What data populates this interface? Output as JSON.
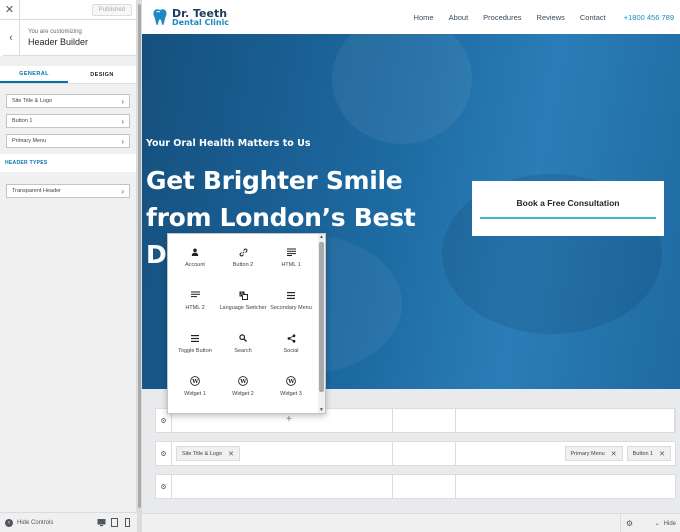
{
  "sidebar": {
    "close_label": "✕",
    "publish_label": "Published",
    "back_label": "‹",
    "crumb": "You are customizing",
    "title": "Header Builder",
    "tabs": [
      {
        "label": "General"
      },
      {
        "label": "Design"
      }
    ],
    "items": [
      {
        "label": "Site Title & Logo"
      },
      {
        "label": "Button 1"
      },
      {
        "label": "Primary Menu"
      }
    ],
    "section_heading": "Header Types",
    "items2": [
      {
        "label": "Transparent Header"
      }
    ],
    "footer": {
      "hide_controls_label": "Hide Controls"
    }
  },
  "site": {
    "logo_line1": "Dr. Teeth",
    "logo_line2": "Dental Clinic",
    "nav": [
      "Home",
      "About",
      "Procedures",
      "Reviews",
      "Contact"
    ],
    "phone": "+1800 456 789",
    "hero_subtitle": "Your Oral Health Matters to Us",
    "hero_title": "Get Brighter Smile\nfrom London’s Best\nD",
    "cta_label": "Book a Free Consultation",
    "brand_color": "#1e88c7",
    "accent_color": "#40b5c5"
  },
  "picker": {
    "items": [
      {
        "label": "Account",
        "icon": "user-icon"
      },
      {
        "label": "Button 2",
        "icon": "link-icon"
      },
      {
        "label": "HTML 1",
        "icon": "text-lines-icon"
      },
      {
        "label": "HTML 2",
        "icon": "text-lines-icon"
      },
      {
        "label": "Language Switcher",
        "icon": "translate-icon"
      },
      {
        "label": "Secondary Menu",
        "icon": "menu-icon"
      },
      {
        "label": "Toggle Button",
        "icon": "menu-icon"
      },
      {
        "label": "Search",
        "icon": "search-icon"
      },
      {
        "label": "Social",
        "icon": "share-icon"
      },
      {
        "label": "Widget 1",
        "icon": "wordpress-icon"
      },
      {
        "label": "Widget 2",
        "icon": "wordpress-icon"
      },
      {
        "label": "Widget 3",
        "icon": "wordpress-icon"
      }
    ]
  },
  "builder": {
    "plus_label": "+",
    "main_row_left": [
      {
        "label": "Site Title & Logo"
      }
    ],
    "main_row_right": [
      {
        "label": "Primary Menu"
      },
      {
        "label": "Button 1"
      }
    ]
  },
  "preview_footer": {
    "hide_label": "Hide"
  }
}
